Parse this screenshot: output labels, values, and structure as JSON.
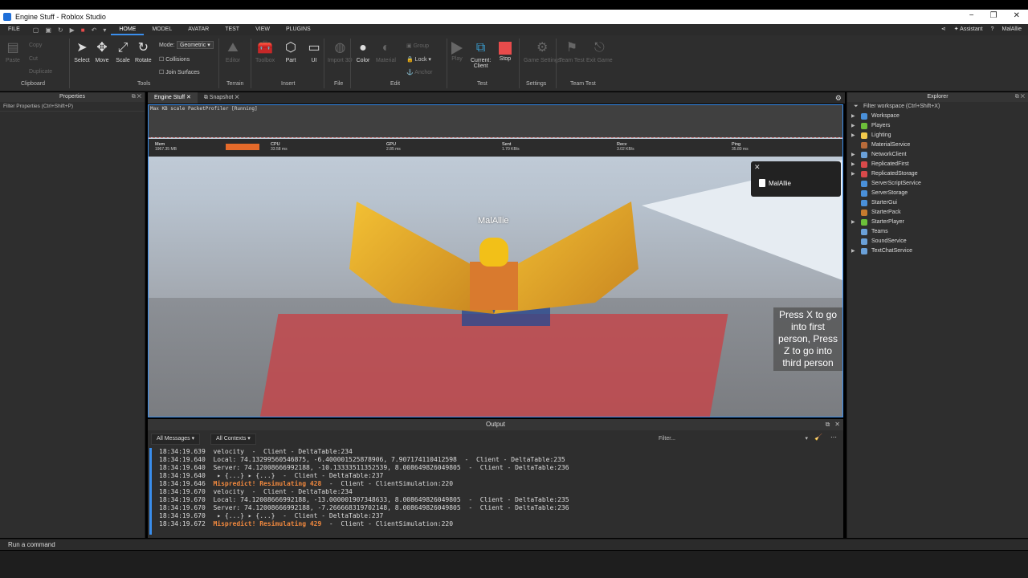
{
  "window": {
    "title": "Engine Stuff - Roblox Studio",
    "minimize": "−",
    "maximize": "❐",
    "close": "✕"
  },
  "menu": {
    "items": [
      "FILE",
      "HOME",
      "MODEL",
      "AVATAR",
      "TEST",
      "VIEW",
      "PLUGINS"
    ],
    "active": "HOME",
    "assistant": "Assistant",
    "user": "MalAllie"
  },
  "ribbon": {
    "clipboard": {
      "paste": "Paste",
      "copy": "Copy",
      "cut": "Cut",
      "duplicate": "Duplicate",
      "group_label": "Clipboard"
    },
    "tools": {
      "select": "Select",
      "move": "Move",
      "scale": "Scale",
      "rotate": "Rotate",
      "mode_label": "Mode:",
      "mode_value": "Geometric",
      "collisions": "Collisions",
      "join_surfaces": "Join Surfaces",
      "group_label": "Tools"
    },
    "terrain": {
      "editor": "Editor",
      "group_label": "Terrain"
    },
    "insert": {
      "toolbox": "Toolbox",
      "part": "Part",
      "ui": "UI",
      "group_label": "Insert"
    },
    "file": {
      "import": "Import 3D",
      "group_label": "File"
    },
    "edit": {
      "color": "Color",
      "material": "Material",
      "group": "Group",
      "lock": "Lock",
      "anchor": "Anchor",
      "group_label": "Edit"
    },
    "test": {
      "play": "Play",
      "current": "Current:",
      "client": "Client",
      "stop": "Stop",
      "group_label": "Test"
    },
    "settings": {
      "game_settings": "Game Settings",
      "group_label": "Settings"
    },
    "team_test": {
      "team_test": "Team Test",
      "exit_game": "Exit Game",
      "group_label": "Team Test"
    }
  },
  "properties": {
    "title": "Properties",
    "filter": "Filter Properties (Ctrl+Shift+P)"
  },
  "tabs": [
    {
      "label": "Engine Stuff",
      "close": "✕"
    },
    {
      "label": "Snapshot",
      "close": "✕"
    }
  ],
  "viewport": {
    "profiler_title": "Max KB scale PacketProfiler [Running]",
    "metrics": [
      {
        "label": "Mem",
        "value": "1967.35 MB"
      },
      {
        "label": "CPU",
        "value": "33.58 ms"
      },
      {
        "label": "GPU",
        "value": "2.85 ms"
      },
      {
        "label": "Sent",
        "value": "1.70 KB/s"
      },
      {
        "label": "Recv",
        "value": "3.02 KB/s"
      },
      {
        "label": "Ping",
        "value": "35.80 ms"
      }
    ],
    "character_name": "MalAllie",
    "popup_name": "MalAllie",
    "hint": "Press X to go into first person, Press Z to go into third person"
  },
  "output": {
    "title": "Output",
    "messages_filter": "All Messages",
    "contexts_filter": "All Contexts",
    "filter_placeholder": "Filter...",
    "lines": [
      {
        "time": "18:34:19.639",
        "msg": "velocity",
        "src": "  -  Client - DeltaTable:234",
        "warn": false
      },
      {
        "time": "18:34:19.640",
        "msg": "Local: 74.13299560546875, -6.400001525878906, 7.907174110412598",
        "src": "  -  Client - DeltaTable:235",
        "warn": false
      },
      {
        "time": "18:34:19.640",
        "msg": "Server: 74.12008666992188, -10.13333511352539, 8.008649826049805",
        "src": "  -  Client - DeltaTable:236",
        "warn": false
      },
      {
        "time": "18:34:19.640",
        "msg": " ▸ {...} ▸ {...}",
        "src": "  -  Client - DeltaTable:237",
        "warn": false
      },
      {
        "time": "18:34:19.646",
        "msg": "Mispredict! Resimulating 428",
        "src": "  -  Client - ClientSimulation:220",
        "warn": true
      },
      {
        "time": "18:34:19.670",
        "msg": "velocity",
        "src": "  -  Client - DeltaTable:234",
        "warn": false
      },
      {
        "time": "18:34:19.670",
        "msg": "Local: 74.12008666992188, -13.000001907348633, 8.008649826049805",
        "src": "  -  Client - DeltaTable:235",
        "warn": false
      },
      {
        "time": "18:34:19.670",
        "msg": "Server: 74.12008666992188, -7.266668319702148, 8.008649826049805",
        "src": "  -  Client - DeltaTable:236",
        "warn": false
      },
      {
        "time": "18:34:19.670",
        "msg": " ▸ {...} ▸ {...}",
        "src": "  -  Client - DeltaTable:237",
        "warn": false
      },
      {
        "time": "18:34:19.672",
        "msg": "Mispredict! Resimulating 429",
        "src": "  -  Client - ClientSimulation:220",
        "warn": true
      }
    ]
  },
  "explorer": {
    "title": "Explorer",
    "filter": "Filter workspace (Ctrl+Shift+X)",
    "items": [
      {
        "label": "Workspace",
        "color": "#4a90d9",
        "expand": true
      },
      {
        "label": "Players",
        "color": "#6cbf3a",
        "expand": true
      },
      {
        "label": "Lighting",
        "color": "#f2c94c",
        "expand": true
      },
      {
        "label": "MaterialService",
        "color": "#b86b3a",
        "expand": false
      },
      {
        "label": "NetworkClient",
        "color": "#6aa0d8",
        "expand": true
      },
      {
        "label": "ReplicatedFirst",
        "color": "#d94a4a",
        "expand": true
      },
      {
        "label": "ReplicatedStorage",
        "color": "#d94a4a",
        "expand": true
      },
      {
        "label": "ServerScriptService",
        "color": "#4a90d9",
        "expand": false
      },
      {
        "label": "ServerStorage",
        "color": "#4a90d9",
        "expand": false
      },
      {
        "label": "StarterGui",
        "color": "#4a90d9",
        "expand": false
      },
      {
        "label": "StarterPack",
        "color": "#c77a2e",
        "expand": false
      },
      {
        "label": "StarterPlayer",
        "color": "#6cbf3a",
        "expand": true
      },
      {
        "label": "Teams",
        "color": "#6aa0d8",
        "expand": false
      },
      {
        "label": "SoundService",
        "color": "#6aa0d8",
        "expand": false
      },
      {
        "label": "TextChatService",
        "color": "#6aa0d8",
        "expand": true
      }
    ]
  },
  "command_bar": {
    "placeholder": "Run a command"
  }
}
